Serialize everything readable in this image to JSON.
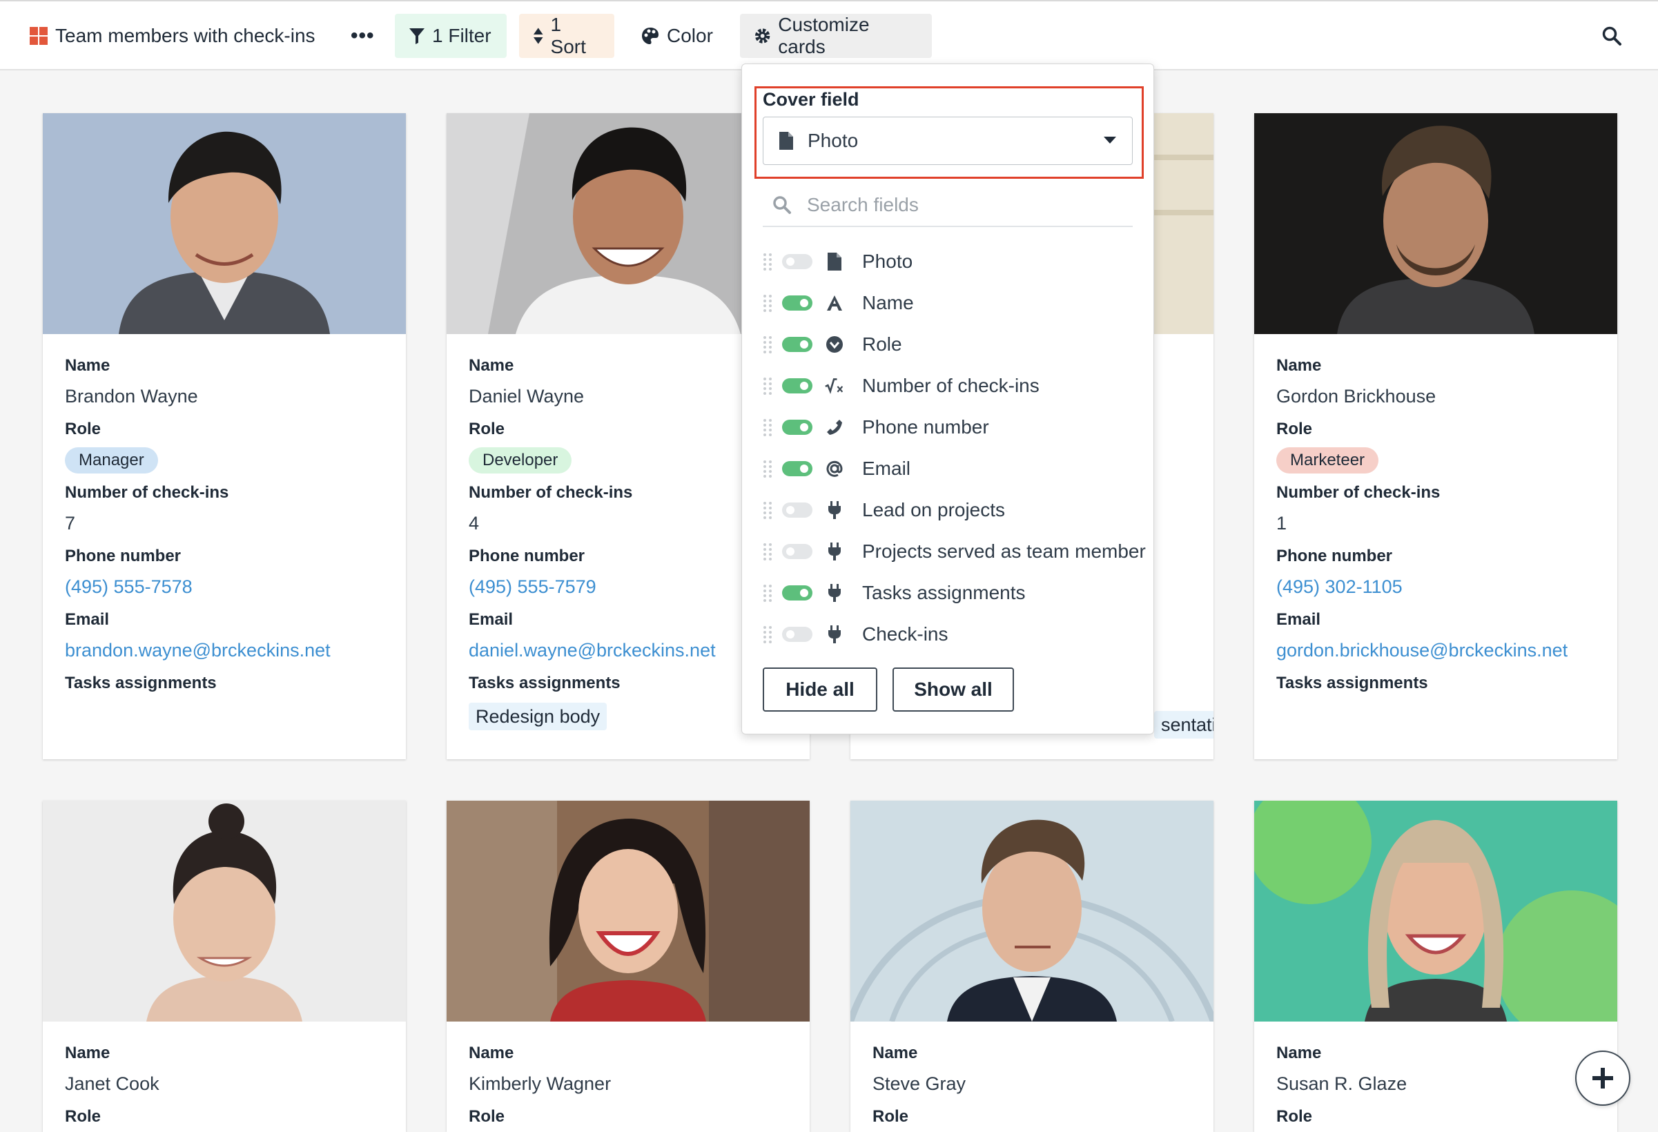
{
  "toolbar": {
    "title": "Team members with check-ins",
    "more": "•••",
    "filter": "1 Filter",
    "sort": "1 Sort",
    "color": "Color",
    "customize": "Customize cards"
  },
  "colors": {
    "link": "#3d8fd1",
    "toggle_on": "#5dbf7c",
    "highlight_border": "#e0402a",
    "filter_bg": "#e6f8ee",
    "sort_bg": "#fcefe3"
  },
  "labels": {
    "name": "Name",
    "role": "Role",
    "checkins": "Number of check-ins",
    "phone": "Phone number",
    "email": "Email",
    "tasks": "Tasks assignments"
  },
  "cards": [
    {
      "name": "Brandon Wayne",
      "role": "Manager",
      "role_bg": "#cfe3f5",
      "checkins": "7",
      "phone": "(495) 555-7578",
      "email": "brandon.wayne@brckeckins.net",
      "tasks": ""
    },
    {
      "name": "Daniel Wayne",
      "role": "Developer",
      "role_bg": "#d8f5df",
      "checkins": "4",
      "phone": "(495) 555-7579",
      "email": "daniel.wayne@brckeckins.net",
      "tasks": "Redesign body"
    },
    {
      "name": "",
      "role": "",
      "checkins": "",
      "phone": "",
      "email": "",
      "tasks": "sentatic"
    },
    {
      "name": "Gordon Brickhouse",
      "role": "Marketeer",
      "role_bg": "#f6cfc8",
      "checkins": "1",
      "phone": "(495) 302-1105",
      "email": "gordon.brickhouse@brckeckins.net",
      "tasks": ""
    },
    {
      "name": "Janet Cook"
    },
    {
      "name": "Kimberly Wagner"
    },
    {
      "name": "Steve Gray"
    },
    {
      "name": "Susan R. Glaze"
    }
  ],
  "customize": {
    "cover_title": "Cover field",
    "cover_value": "Photo",
    "search_placeholder": "Search fields",
    "fields": [
      {
        "label": "Photo",
        "on": false,
        "icon": "file-icon"
      },
      {
        "label": "Name",
        "on": true,
        "icon": "text-icon"
      },
      {
        "label": "Role",
        "on": true,
        "icon": "select-icon"
      },
      {
        "label": "Number of check-ins",
        "on": true,
        "icon": "formula-icon"
      },
      {
        "label": "Phone number",
        "on": true,
        "icon": "phone-icon"
      },
      {
        "label": "Email",
        "on": true,
        "icon": "at-icon"
      },
      {
        "label": "Lead on projects",
        "on": false,
        "icon": "plug-icon"
      },
      {
        "label": "Projects served as team member",
        "on": false,
        "icon": "plug-icon"
      },
      {
        "label": "Tasks assignments",
        "on": true,
        "icon": "plug-icon"
      },
      {
        "label": "Check-ins",
        "on": false,
        "icon": "plug-icon"
      }
    ],
    "hide_all": "Hide all",
    "show_all": "Show all"
  }
}
